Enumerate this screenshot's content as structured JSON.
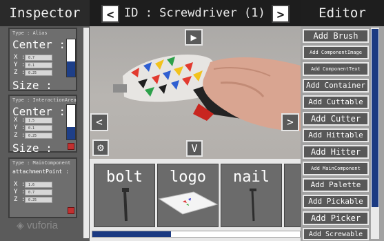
{
  "inspector": {
    "title": "Inspector",
    "cards": [
      {
        "type": "Type :    Alias",
        "center_label": "Center :",
        "fields": [
          {
            "axis": "X :",
            "value": "0.7"
          },
          {
            "axis": "Y :",
            "value": "0.1"
          },
          {
            "axis": "Z :",
            "value": "0.25"
          }
        ],
        "size_label": "Size :"
      },
      {
        "type": "Type : InteractionArea",
        "center_label": "Center :",
        "fields": [
          {
            "axis": "X :",
            "value": "1.5"
          },
          {
            "axis": "Y :",
            "value": "0.1"
          },
          {
            "axis": "Z :",
            "value": "0.25"
          }
        ],
        "size_label": "Size :"
      },
      {
        "type": "Type : MainComponent",
        "sub_label": "attachmentPoint :",
        "fields": [
          {
            "axis": "X :",
            "value": "1.6"
          },
          {
            "axis": "Y :",
            "value": "0.7"
          },
          {
            "axis": "Z :",
            "value": "0.25"
          }
        ]
      }
    ],
    "watermark": "vuforia"
  },
  "topbar": {
    "prev": "<",
    "title": "ID : Screwdriver (1)",
    "next": ">"
  },
  "viewport": {
    "play": "▶",
    "left": "<",
    "right": ">",
    "down": "V",
    "settings": "⚙"
  },
  "palette": {
    "items": [
      {
        "name": "bolt"
      },
      {
        "name": "logo"
      },
      {
        "name": "nail"
      }
    ],
    "scroll_fraction": 0.38
  },
  "editor": {
    "title": "Editor",
    "buttons": [
      "Add Brush",
      "Add ComponentImage",
      "Add ComponentText",
      "Add Container",
      "Add Cuttable",
      "Add Cutter",
      "Add Hittable",
      "Add Hitter",
      "Add MainComponent",
      "Add Palette",
      "Add Pickable",
      "Add Picker",
      "Add Screwable"
    ]
  }
}
